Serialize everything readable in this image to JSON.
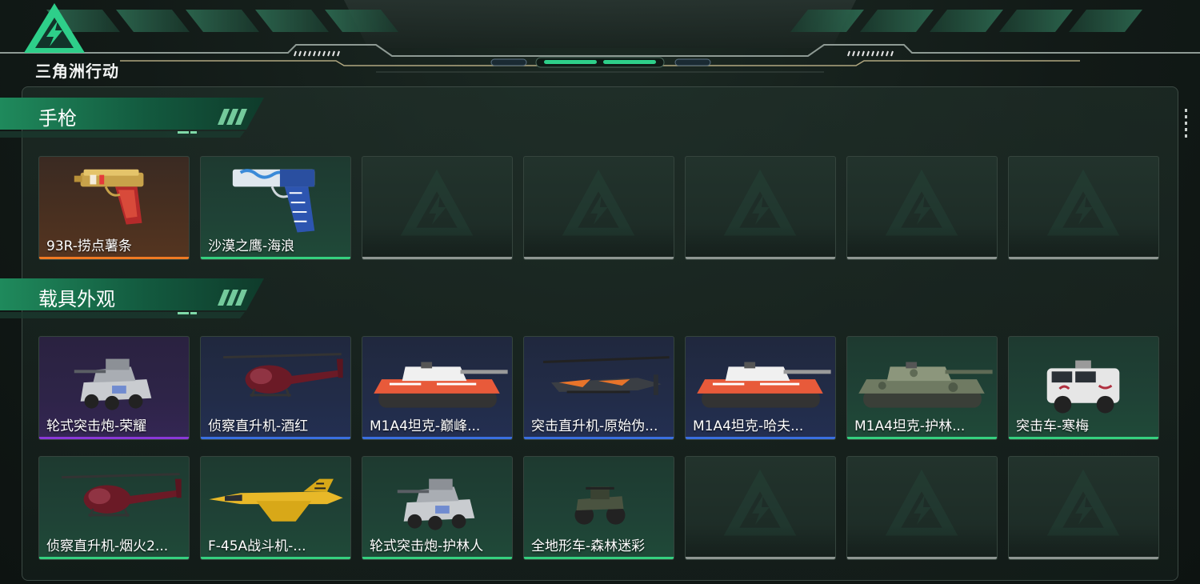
{
  "header": {
    "logo_text": "三角洲行动"
  },
  "colors": {
    "accent": "#2ecf8a",
    "rarity_orange": "#f07a23",
    "rarity_green": "#35d07f",
    "rarity_purple": "#8a38d8",
    "rarity_blue": "#3a6fe0",
    "empty_bar": "#8e9692"
  },
  "sections": [
    {
      "title": "手枪",
      "items": [
        {
          "name": "93R-捞点薯条",
          "rarity": "orange",
          "icon": "pistol-93r-icon"
        },
        {
          "name": "沙漠之鹰-海浪",
          "rarity": "green",
          "icon": "desert-eagle-icon"
        },
        {
          "name": "",
          "rarity": "empty",
          "icon": "empty-slot-icon"
        },
        {
          "name": "",
          "rarity": "empty",
          "icon": "empty-slot-icon"
        },
        {
          "name": "",
          "rarity": "empty",
          "icon": "empty-slot-icon"
        },
        {
          "name": "",
          "rarity": "empty",
          "icon": "empty-slot-icon"
        },
        {
          "name": "",
          "rarity": "empty",
          "icon": "empty-slot-icon"
        }
      ]
    },
    {
      "title": "载具外观",
      "items": [
        {
          "name": "轮式突击炮-荣耀",
          "rarity": "purple",
          "icon": "wheeled-assault-gun-icon"
        },
        {
          "name": "侦察直升机-酒红",
          "rarity": "blue",
          "icon": "scout-helicopter-icon"
        },
        {
          "name": "M1A4坦克-巅峰...",
          "rarity": "blue",
          "icon": "tank-icon"
        },
        {
          "name": "突击直升机-原始伪...",
          "rarity": "blue",
          "icon": "attack-helicopter-icon"
        },
        {
          "name": "M1A4坦克-哈夫...",
          "rarity": "blue",
          "icon": "tank-icon"
        },
        {
          "name": "M1A4坦克-护林...",
          "rarity": "green",
          "icon": "tank-camo-icon"
        },
        {
          "name": "突击车-寒梅",
          "rarity": "green",
          "icon": "assault-vehicle-icon"
        },
        {
          "name": "侦察直升机-烟火2...",
          "rarity": "green",
          "icon": "scout-helicopter-icon"
        },
        {
          "name": "F-45A战斗机-...",
          "rarity": "green",
          "icon": "fighter-jet-icon"
        },
        {
          "name": "轮式突击炮-护林人",
          "rarity": "green",
          "icon": "wheeled-assault-gun-icon"
        },
        {
          "name": "全地形车-森林迷彩",
          "rarity": "green",
          "icon": "atv-icon"
        },
        {
          "name": "",
          "rarity": "empty",
          "icon": "empty-slot-icon"
        },
        {
          "name": "",
          "rarity": "empty",
          "icon": "empty-slot-icon"
        },
        {
          "name": "",
          "rarity": "empty",
          "icon": "empty-slot-icon"
        }
      ]
    }
  ]
}
